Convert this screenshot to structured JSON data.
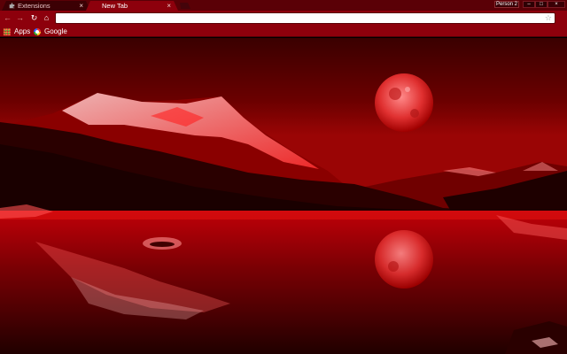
{
  "tabs": [
    {
      "label": "Extensions",
      "active": false
    },
    {
      "label": "New Tab",
      "active": true
    }
  ],
  "profile": {
    "label": "Person 2"
  },
  "window_controls": {
    "minimize": "–",
    "maximize": "□",
    "close": "×"
  },
  "toolbar": {
    "back_icon": "←",
    "forward_icon": "→",
    "reload_icon": "↻",
    "home_icon": "⌂",
    "address_value": "",
    "star_icon": "☆"
  },
  "bookmarks": [
    {
      "label": "Apps",
      "icon": "apps-grid-icon"
    },
    {
      "label": "Google",
      "icon": "google-icon"
    }
  ],
  "theme_colors": {
    "frame": "#5a0006",
    "toolbar": "#8d000c",
    "accent": "#ff1a1a"
  }
}
